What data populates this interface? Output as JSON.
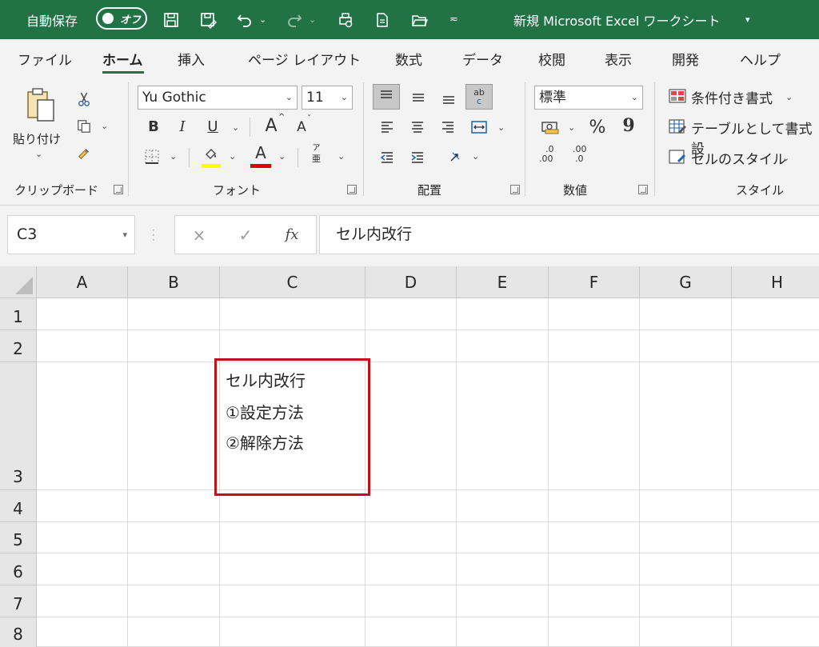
{
  "titlebar": {
    "autosave_label": "自動保存",
    "autosave_state": "オフ",
    "window_title": "新規 Microsoft Excel ワークシート",
    "bg_color": "#217346"
  },
  "tabs": [
    {
      "label": "ファイル",
      "active": false
    },
    {
      "label": "ホーム",
      "active": true
    },
    {
      "label": "挿入",
      "active": false
    },
    {
      "label": "ページ レイアウト",
      "active": false
    },
    {
      "label": "数式",
      "active": false
    },
    {
      "label": "データ",
      "active": false
    },
    {
      "label": "校閲",
      "active": false
    },
    {
      "label": "表示",
      "active": false
    },
    {
      "label": "開発",
      "active": false
    },
    {
      "label": "ヘルプ",
      "active": false
    }
  ],
  "clipboard": {
    "paste_label": "貼り付け",
    "group_label": "クリップボード"
  },
  "font": {
    "font_name": "Yu Gothic",
    "font_size": "11",
    "bold_label": "B",
    "italic_label": "I",
    "underline_label": "U",
    "grow_label": "A",
    "shrink_label": "A",
    "font_color_label": "A",
    "phonetic_top": "ア",
    "phonetic_bottom": "亜",
    "group_label": "フォント",
    "fill_color": "#ffff00",
    "font_color": "#e00000"
  },
  "alignment": {
    "wrap_text_top": "ab",
    "wrap_text_bottom": "c",
    "group_label": "配置"
  },
  "number": {
    "format": "標準",
    "percent_label": "%",
    "comma_label": "9",
    "inc_decimal_top": ".0",
    "inc_decimal_bottom": ".00",
    "dec_decimal_top": ".00",
    "dec_decimal_bottom": ".0",
    "group_label": "数値"
  },
  "styles": {
    "conditional_formatting": "条件付き書式",
    "format_as_table": "テーブルとして書式設",
    "cell_styles": "セルのスタイル",
    "group_label": "スタイル"
  },
  "formula_bar": {
    "name_box": "C3",
    "cancel_icon": "×",
    "enter_icon": "✓",
    "fx_label": "fx",
    "content": "セル内改行"
  },
  "grid": {
    "columns": [
      "A",
      "B",
      "C",
      "D",
      "E",
      "F",
      "G",
      "H"
    ],
    "rows": [
      "1",
      "2",
      "3",
      "4",
      "5",
      "6",
      "7",
      "8"
    ],
    "c3_lines": [
      "セル内改行",
      "①設定方法",
      "②解除方法"
    ],
    "highlight_color": "#c0121b"
  }
}
